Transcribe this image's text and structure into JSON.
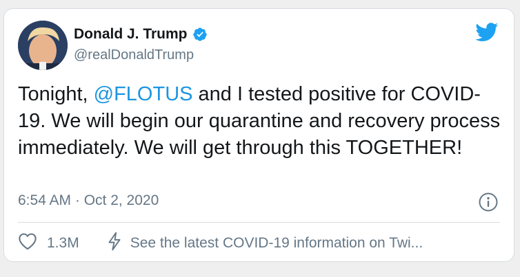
{
  "author": {
    "name": "Donald J. Trump",
    "handle": "@realDonaldTrump",
    "verified": true
  },
  "tweet": {
    "text_before": "Tonight, ",
    "mention": "@FLOTUS",
    "text_after": " and I tested positive for COVID-19. We will begin our quarantine and recovery process immediately. We will get through this TOGETHER!"
  },
  "timestamp": "6:54 AM · Oct 2, 2020",
  "actions": {
    "like_count": "1.3M",
    "covid_link_label": "See the latest COVID-19 information on Twi..."
  },
  "icons": {
    "brand": "twitter-bird-icon",
    "verified": "verified-badge-icon",
    "info": "info-icon",
    "like": "heart-icon",
    "covid": "lightning-bolt-icon"
  },
  "colors": {
    "brand_blue": "#1da1f2",
    "mention_blue": "#1b95e0",
    "text": "#14171a",
    "secondary": "#657786",
    "divider": "#d7dde2"
  }
}
